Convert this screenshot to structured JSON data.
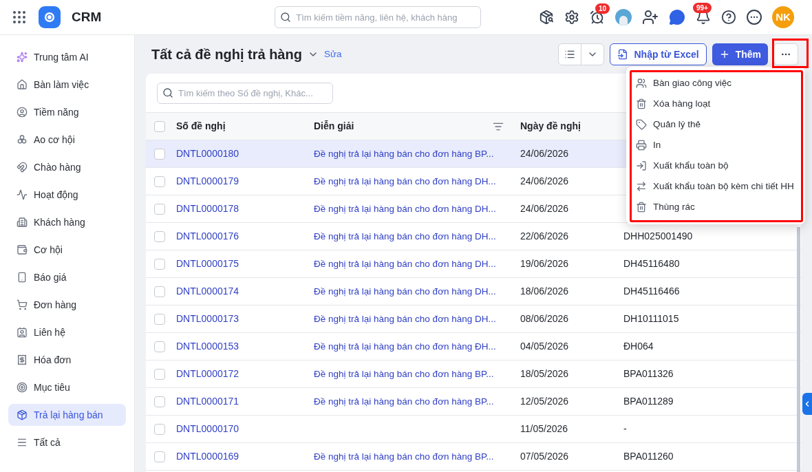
{
  "app": {
    "title": "CRM"
  },
  "global_search": {
    "placeholder": "Tìm kiếm tiềm năng, liên hệ, khách hàng"
  },
  "header_badges": {
    "reminders": "10",
    "notifications": "99+"
  },
  "user": {
    "initials": "NK"
  },
  "sidebar": {
    "items": [
      {
        "label": "Trung tâm AI",
        "selected": false
      },
      {
        "label": "Bàn làm việc",
        "selected": false
      },
      {
        "label": "Tiềm năng",
        "selected": false
      },
      {
        "label": "Ao cơ hội",
        "selected": false
      },
      {
        "label": "Chào hàng",
        "selected": false
      },
      {
        "label": "Hoạt động",
        "selected": false
      },
      {
        "label": "Khách hàng",
        "selected": false
      },
      {
        "label": "Cơ hội",
        "selected": false
      },
      {
        "label": "Báo giá",
        "selected": false
      },
      {
        "label": "Đơn hàng",
        "selected": false
      },
      {
        "label": "Liên hệ",
        "selected": false
      },
      {
        "label": "Hóa đơn",
        "selected": false
      },
      {
        "label": "Mục tiêu",
        "selected": false
      },
      {
        "label": "Trả lại hàng bán",
        "selected": true
      },
      {
        "label": "Tất cả",
        "selected": false
      }
    ]
  },
  "page": {
    "title": "Tất cả đề nghị trả hàng",
    "edit_link": "Sửa",
    "import_button": "Nhập từ Excel",
    "add_button": "Thêm"
  },
  "table": {
    "search": {
      "placeholder": "Tìm kiếm theo Số đề nghị, Khác..."
    },
    "select_all": {
      "checked": false
    },
    "columns": [
      "Số đề nghị",
      "Diễn giải",
      "Ngày đề nghị"
    ],
    "rows": [
      {
        "selected": true,
        "checked": false,
        "number": "DNTL0000180",
        "description": "Đề nghị trả lại hàng bán cho đơn hàng BP...",
        "date": "24/06/2026"
      },
      {
        "selected": false,
        "checked": false,
        "number": "DNTL0000179",
        "description": "Đề nghị trả lại hàng bán cho đơn hàng DH...",
        "date": "24/06/2026"
      },
      {
        "selected": false,
        "checked": false,
        "number": "DNTL0000178",
        "description": "Đề nghị trả lại hàng bán cho đơn hàng DH...",
        "date": "24/06/2026"
      },
      {
        "selected": false,
        "checked": false,
        "number": "DNTL0000176",
        "description": "Đề nghị trả lại hàng bán cho đơn hàng DH...",
        "date": "22/06/2026",
        "column_4": "DHH025001490"
      },
      {
        "selected": false,
        "checked": false,
        "number": "DNTL0000175",
        "description": "Đề nghị trả lại hàng bán cho đơn hàng DH...",
        "date": "19/06/2026",
        "column_4": "DH45116480"
      },
      {
        "selected": false,
        "checked": false,
        "number": "DNTL0000174",
        "description": "Đề nghị trả lại hàng bán cho đơn hàng DH...",
        "date": "18/06/2026",
        "column_4": "DH45116466"
      },
      {
        "selected": false,
        "checked": false,
        "number": "DNTL0000173",
        "description": "Đề nghị trả lại hàng bán cho đơn hàng DH...",
        "date": "08/06/2026",
        "column_4": "DH10111015"
      },
      {
        "selected": false,
        "checked": false,
        "number": "DNTL0000153",
        "description": "Đề nghị trả lại hàng bán cho đơn hàng ĐH...",
        "date": "04/05/2026",
        "column_4": "ĐH064"
      },
      {
        "selected": false,
        "checked": false,
        "number": "DNTL0000172",
        "description": "Đề nghị trả lại hàng bán cho đơn hàng BP...",
        "date": "18/05/2026",
        "column_4": "BPA011326"
      },
      {
        "selected": false,
        "checked": false,
        "number": "DNTL0000171",
        "description": "Đề nghị trả lại hàng bán cho đơn hàng BP...",
        "date": "12/05/2026",
        "column_4": "BPA011289"
      },
      {
        "selected": false,
        "checked": false,
        "number": "DNTL0000170",
        "date": "11/05/2026",
        "column_4": "-"
      },
      {
        "selected": false,
        "checked": false,
        "number": "DNTL0000169",
        "description": "Đề nghị trả lại hàng bán cho đơn hàng BP...",
        "date": "07/05/2026",
        "column_4": "BPA011260"
      }
    ]
  },
  "more_menu": {
    "items": [
      "Bàn giao công việc",
      "Xóa hàng loạt",
      "Quản lý thẻ",
      "In",
      "Xuất khẩu toàn bộ",
      "Xuất khẩu toàn bộ kèm chi tiết HH",
      "Thùng rác"
    ]
  }
}
